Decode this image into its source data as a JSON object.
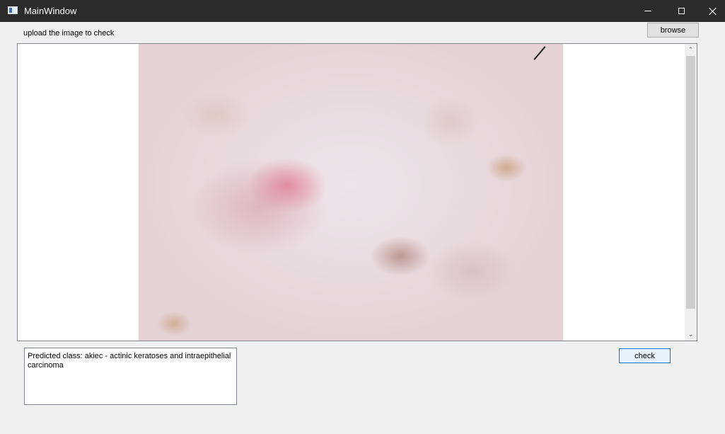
{
  "window": {
    "title": "MainWindow",
    "controls": {
      "minimize": "minimize-icon",
      "maximize": "maximize-icon",
      "close": "close-icon"
    }
  },
  "upload": {
    "label": "upload the image to check",
    "browse_label": "browse"
  },
  "image_view": {
    "image_icon": "skin-lesion-dermoscopy-image",
    "scroll_up_icon": "chevron-up-icon",
    "scroll_down_icon": "chevron-down-icon"
  },
  "result": {
    "text": "Predicted class: akiec - actinic keratoses and intraepithelial carcinoma"
  },
  "check": {
    "label": "check"
  },
  "colors": {
    "titlebar": "#2b2b2b",
    "window_bg": "#f0f0f0",
    "accent": "#0078d7"
  }
}
